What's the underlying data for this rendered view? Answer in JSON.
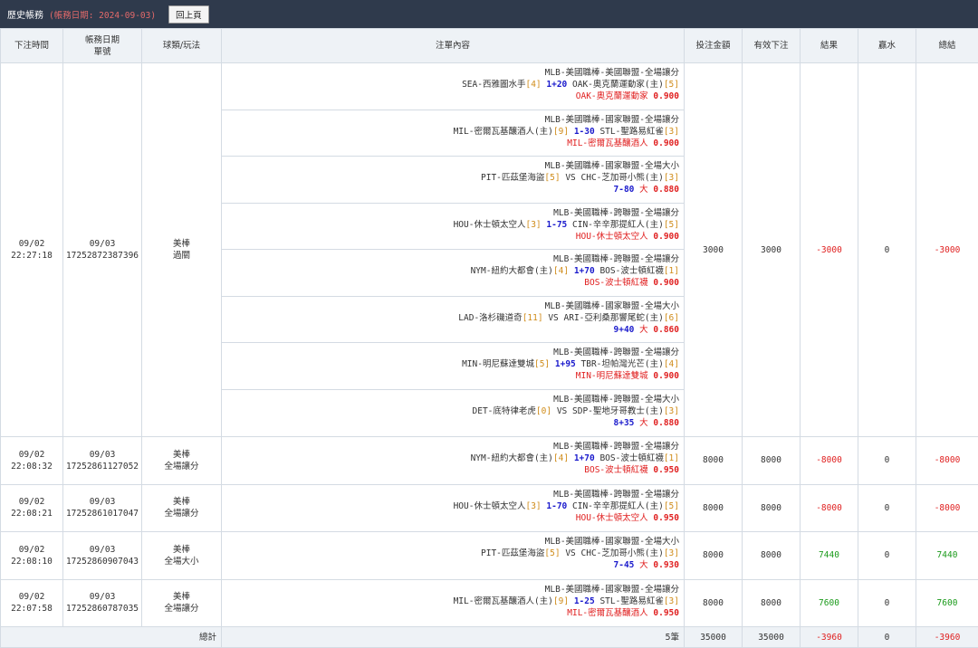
{
  "header": {
    "title": "歷史帳務",
    "date_label": "(帳務日期: 2024-09-03)",
    "back_button": "回上頁"
  },
  "columns": {
    "time": "下注時間",
    "date_line1": "帳務日期",
    "date_line2": "單號",
    "type": "球類/玩法",
    "content": "注單內容",
    "amount": "投注金額",
    "valid": "有效下注",
    "result": "結果",
    "commission": "贏水",
    "total": "總結"
  },
  "rows": [
    {
      "time_date": "09/02",
      "time_clock": "22:27:18",
      "acct_date": "09/03",
      "ticket": "17252872387396",
      "sport": "美棒",
      "play": "過關",
      "amount": "3000",
      "valid": "3000",
      "result": "-3000",
      "commission": "0",
      "total": "-3000",
      "bets": [
        {
          "league": "MLB-美國職棒-美國聯盟-全場讓分",
          "home": "SEA-西雅圖水手",
          "home_p": "[4]",
          "mid": "1+20",
          "away": "OAK-奧克蘭運動家(主)",
          "away_p": "[5]",
          "pick": "OAK-奧克蘭運動家",
          "odds": "0.900"
        },
        {
          "league": "MLB-美國職棒-國家聯盟-全場讓分",
          "home": "MIL-密爾瓦基釀酒人(主)",
          "home_p": "[9]",
          "mid": "1-30",
          "away": "STL-聖路易紅雀",
          "away_p": "[3]",
          "pick": "MIL-密爾瓦基釀酒人",
          "odds": "0.900"
        },
        {
          "league": "MLB-美國職棒-國家聯盟-全場大小",
          "home": "PIT-匹茲堡海盜",
          "home_p": "[5]",
          "mid": "VS",
          "away": "CHC-芝加哥小熊(主)",
          "away_p": "[3]",
          "ou_line": "7-80",
          "pick": "大",
          "odds": "0.880"
        },
        {
          "league": "MLB-美國職棒-跨聯盟-全場讓分",
          "home": "HOU-休士頓太空人",
          "home_p": "[3]",
          "mid": "1-75",
          "away": "CIN-辛辛那提紅人(主)",
          "away_p": "[5]",
          "pick": "HOU-休士頓太空人",
          "odds": "0.900"
        },
        {
          "league": "MLB-美國職棒-跨聯盟-全場讓分",
          "home": "NYM-紐約大都會(主)",
          "home_p": "[4]",
          "mid": "1+70",
          "away": "BOS-波士頓紅襪",
          "away_p": "[1]",
          "pick": "BOS-波士頓紅襪",
          "odds": "0.900"
        },
        {
          "league": "MLB-美國職棒-國家聯盟-全場大小",
          "home": "LAD-洛杉磯道奇",
          "home_p": "[11]",
          "mid": "VS",
          "away": "ARI-亞利桑那響尾蛇(主)",
          "away_p": "[6]",
          "ou_line": "9+40",
          "pick": "大",
          "odds": "0.860"
        },
        {
          "league": "MLB-美國職棒-跨聯盟-全場讓分",
          "home": "MIN-明尼蘇達雙城",
          "home_p": "[5]",
          "mid": "1+95",
          "away": "TBR-坦帕灣光芒(主)",
          "away_p": "[4]",
          "pick": "MIN-明尼蘇達雙城",
          "odds": "0.900"
        },
        {
          "league": "MLB-美國職棒-跨聯盟-全場大小",
          "home": "DET-底特律老虎",
          "home_p": "[0]",
          "mid": "VS",
          "away": "SDP-聖地牙哥教士(主)",
          "away_p": "[3]",
          "ou_line": "8+35",
          "pick": "大",
          "odds": "0.880"
        }
      ]
    },
    {
      "time_date": "09/02",
      "time_clock": "22:08:32",
      "acct_date": "09/03",
      "ticket": "17252861127052",
      "sport": "美棒",
      "play": "全場讓分",
      "amount": "8000",
      "valid": "8000",
      "result": "-8000",
      "commission": "0",
      "total": "-8000",
      "bets": [
        {
          "league": "MLB-美國職棒-跨聯盟-全場讓分",
          "home": "NYM-紐約大都會(主)",
          "home_p": "[4]",
          "mid": "1+70",
          "away": "BOS-波士頓紅襪",
          "away_p": "[1]",
          "pick": "BOS-波士頓紅襪",
          "odds": "0.950"
        }
      ]
    },
    {
      "time_date": "09/02",
      "time_clock": "22:08:21",
      "acct_date": "09/03",
      "ticket": "17252861017047",
      "sport": "美棒",
      "play": "全場讓分",
      "amount": "8000",
      "valid": "8000",
      "result": "-8000",
      "commission": "0",
      "total": "-8000",
      "bets": [
        {
          "league": "MLB-美國職棒-跨聯盟-全場讓分",
          "home": "HOU-休士頓太空人",
          "home_p": "[3]",
          "mid": "1-70",
          "away": "CIN-辛辛那提紅人(主)",
          "away_p": "[5]",
          "pick": "HOU-休士頓太空人",
          "odds": "0.950"
        }
      ]
    },
    {
      "time_date": "09/02",
      "time_clock": "22:08:10",
      "acct_date": "09/03",
      "ticket": "17252860907043",
      "sport": "美棒",
      "play": "全場大小",
      "amount": "8000",
      "valid": "8000",
      "result": "7440",
      "commission": "0",
      "total": "7440",
      "bets": [
        {
          "league": "MLB-美國職棒-國家聯盟-全場大小",
          "home": "PIT-匹茲堡海盜",
          "home_p": "[5]",
          "mid": "VS",
          "away": "CHC-芝加哥小熊(主)",
          "away_p": "[3]",
          "ou_line": "7-45",
          "pick": "大",
          "odds": "0.930"
        }
      ]
    },
    {
      "time_date": "09/02",
      "time_clock": "22:07:58",
      "acct_date": "09/03",
      "ticket": "17252860787035",
      "sport": "美棒",
      "play": "全場讓分",
      "amount": "8000",
      "valid": "8000",
      "result": "7600",
      "commission": "0",
      "total": "7600",
      "bets": [
        {
          "league": "MLB-美國職棒-國家聯盟-全場讓分",
          "home": "MIL-密爾瓦基釀酒人(主)",
          "home_p": "[9]",
          "mid": "1-25",
          "away": "STL-聖路易紅雀",
          "away_p": "[3]",
          "pick": "MIL-密爾瓦基釀酒人",
          "odds": "0.950"
        }
      ]
    }
  ],
  "footer": {
    "label": "總計",
    "count": "5筆",
    "amount": "35000",
    "valid": "35000",
    "result": "-3960",
    "commission": "0",
    "total": "-3960"
  },
  "colors": {
    "header_bg": "#2f3a4c",
    "table_head_bg": "#eef2f6",
    "negative": "#e02020",
    "positive": "#1a9a1a",
    "handicap": "#1a1acc",
    "pitcher": "#d08c1a"
  }
}
